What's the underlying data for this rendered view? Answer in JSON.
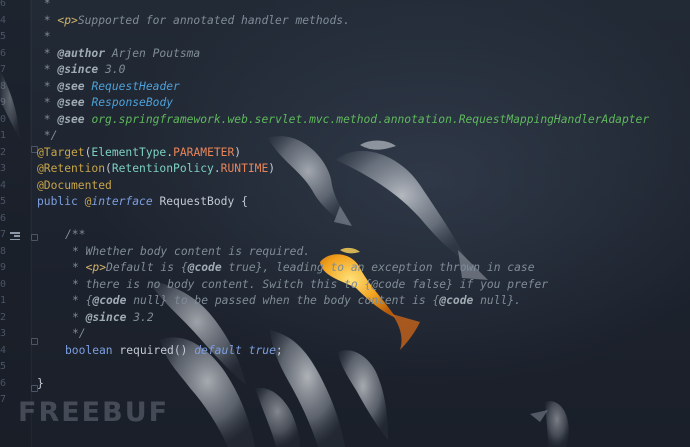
{
  "editor": {
    "line_numbers": [
      "6",
      "4",
      "5",
      "6",
      "7",
      "8",
      "9",
      "0",
      "1",
      "2",
      "3",
      "4",
      "5",
      "6",
      "7",
      "8",
      "9",
      "0",
      "1",
      "2",
      "3",
      "4",
      "5",
      "6",
      "7"
    ],
    "doc_comment": {
      "l1_star": " *",
      "l2_star": " * ",
      "l2_tag": "<p>",
      "l2_text": "Supported for annotated handler methods.",
      "l3_star": " *",
      "l4_star": " * ",
      "l4_tag": "@author",
      "l4_text": " Arjen Poutsma",
      "l5_star": " * ",
      "l5_tag": "@since",
      "l5_text": " 3.0",
      "l6_star": " * ",
      "l6_tag": "@see",
      "l6_link": "RequestHeader",
      "l7_star": " * ",
      "l7_tag": "@see",
      "l7_link": "ResponseBody",
      "l8_star": " * ",
      "l8_tag": "@see",
      "l8_pkg": "org.springframework.web.servlet.mvc.method.annotation.RequestMappingHandlerAdapter",
      "l9_end": " */"
    },
    "decl": {
      "target_ann": "@Target",
      "target_open": "(",
      "target_cls": "ElementType",
      "target_dot": ".",
      "target_const": "PARAMETER",
      "target_close": ")",
      "ret_ann": "@Retention",
      "ret_open": "(",
      "ret_cls": "RetentionPolicy",
      "ret_dot": ".",
      "ret_const": "RUNTIME",
      "ret_close": ")",
      "doc_ann": "@Documented",
      "public_kw": "public ",
      "iface_at": "@",
      "iface_kw": "interface",
      "iface_name": " RequestBody ",
      "iface_brace": "{"
    },
    "member_doc": {
      "open": "/**",
      "m1": "* Whether body content is required.",
      "m2_star": "* ",
      "m2_tag": "<p>",
      "m2_text": "Default is {",
      "m2_code": "@code",
      "m2_rest": " true}, leading to an exception thrown in case",
      "m3": "* there is no body content. Switch this to {@code false} if you prefer",
      "m4_star": "* {",
      "m4_code": "@code",
      "m4_rest": " null} to be passed when the body content is {",
      "m4_code2": "@code",
      "m4_end": " null}.",
      "m5_star": "* ",
      "m5_tag": "@since",
      "m5_text": " 3.2",
      "close": "*/"
    },
    "member": {
      "type_kw": "boolean ",
      "name": "required() ",
      "default_kw": "default ",
      "value_kw": "true",
      "semi": ";"
    },
    "closing_brace": "}"
  },
  "wallpaper": {
    "watermark_text": "FREEBUF"
  }
}
